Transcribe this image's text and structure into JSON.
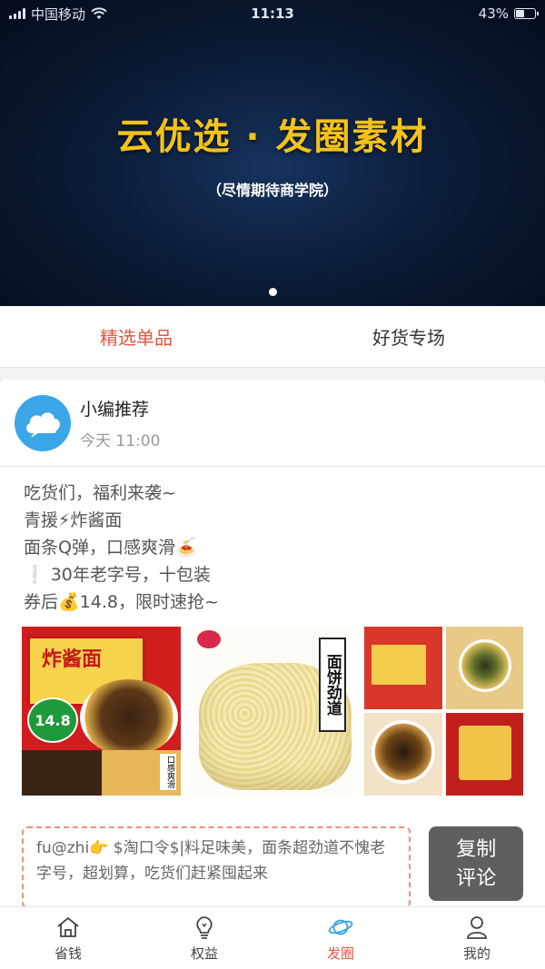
{
  "status_bar": {
    "carrier": "中国移动",
    "time": "11:13",
    "battery": "43%",
    "battery_level": 0.43
  },
  "banner": {
    "title": "云优选 · 发圈素材",
    "subtitle": "（尽情期待商学院）",
    "dot_count": 1
  },
  "tabs": [
    {
      "label": "精选单品",
      "active": true
    },
    {
      "label": "好货专场",
      "active": false
    }
  ],
  "post": {
    "author": "小编推荐",
    "time": "今天 11:00",
    "lines": [
      "吃货们，福利来袭~",
      "青援⚡炸酱面",
      "面条Q弹，口感爽滑🍝",
      "❕ 30年老字号，十包装",
      "券后💰14.8，限时速抢~"
    ],
    "photos": {
      "p1_pkg_text": "炸酱面",
      "p1_price": "14.8",
      "p1_label": "口感爽滑",
      "p2_label": "面饼劲道"
    },
    "comment": "fu@zhi👉 $淘口令$|料足味美，面条超劲道不愧老字号，超划算，吃货们赶紧囤起来",
    "copy_button": {
      "line1": "复制",
      "line2": "评论"
    }
  },
  "bottom_nav": [
    {
      "label": "省钱",
      "icon": "home-icon",
      "active": false
    },
    {
      "label": "权益",
      "icon": "lightbulb-icon",
      "active": false
    },
    {
      "label": "发圈",
      "icon": "planet-icon",
      "active": true
    },
    {
      "label": "我的",
      "icon": "user-icon",
      "active": false
    }
  ],
  "colors": {
    "accent": "#e8543f",
    "banner_title": "#f5c21a",
    "avatar": "#3aa6e8",
    "copy_button": "#5f5f5f"
  }
}
